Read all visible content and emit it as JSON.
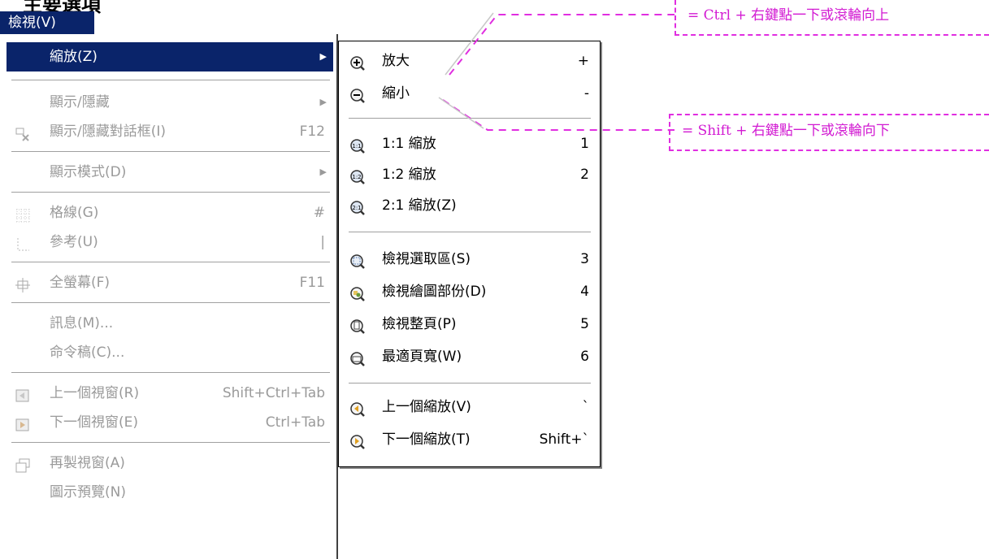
{
  "page": {
    "heading": "主要選項"
  },
  "menubar": {
    "view_label": "檢視(V)"
  },
  "main_menu": {
    "items": [
      {
        "label": "縮放(Z)",
        "shortcut": "",
        "has_submenu": true,
        "enabled": true,
        "highlighted": true,
        "icon": ""
      },
      {
        "label": "顯示/隱藏",
        "shortcut": "",
        "has_submenu": true,
        "enabled": false,
        "icon": ""
      },
      {
        "label": "顯示/隱藏對話框(I)",
        "shortcut": "F12",
        "has_submenu": false,
        "enabled": false,
        "icon": "toggle-dialogs-icon"
      },
      {
        "label": "顯示模式(D)",
        "shortcut": "",
        "has_submenu": true,
        "enabled": false,
        "icon": ""
      },
      {
        "label": "格線(G)",
        "shortcut": "#",
        "has_submenu": false,
        "enabled": false,
        "icon": "grid-icon"
      },
      {
        "label": "參考(U)",
        "shortcut": "|",
        "has_submenu": false,
        "enabled": false,
        "icon": "guides-icon"
      },
      {
        "label": "全螢幕(F)",
        "shortcut": "F11",
        "has_submenu": false,
        "enabled": false,
        "icon": "fullscreen-icon"
      },
      {
        "label": "訊息(M)...",
        "shortcut": "",
        "has_submenu": false,
        "enabled": false,
        "icon": ""
      },
      {
        "label": "命令稿(C)...",
        "shortcut": "",
        "has_submenu": false,
        "enabled": false,
        "icon": ""
      },
      {
        "label": "上一個視窗(R)",
        "shortcut": "Shift+Ctrl+Tab",
        "has_submenu": false,
        "enabled": false,
        "icon": "prev-window-icon"
      },
      {
        "label": "下一個視窗(E)",
        "shortcut": "Ctrl+Tab",
        "has_submenu": false,
        "enabled": false,
        "icon": "next-window-icon"
      },
      {
        "label": "再製視窗(A)",
        "shortcut": "",
        "has_submenu": false,
        "enabled": false,
        "icon": "duplicate-window-icon"
      },
      {
        "label": "圖示預覽(N)",
        "shortcut": "",
        "has_submenu": false,
        "enabled": false,
        "icon": ""
      }
    ]
  },
  "zoom_submenu": {
    "items": [
      {
        "label": "放大",
        "shortcut": "+",
        "icon": "zoom-in-icon"
      },
      {
        "label": "縮小",
        "shortcut": "-",
        "icon": "zoom-out-icon"
      },
      {
        "label": "1:1 縮放",
        "shortcut": "1",
        "icon": "zoom-1-1-icon"
      },
      {
        "label": "1:2 縮放",
        "shortcut": "2",
        "icon": "zoom-1-2-icon"
      },
      {
        "label": "2:1 縮放(Z)",
        "shortcut": "",
        "icon": "zoom-2-1-icon"
      },
      {
        "label": "檢視選取區(S)",
        "shortcut": "3",
        "icon": "zoom-selection-icon"
      },
      {
        "label": "檢視繪圖部份(D)",
        "shortcut": "4",
        "icon": "zoom-drawing-icon"
      },
      {
        "label": "檢視整頁(P)",
        "shortcut": "5",
        "icon": "zoom-page-icon"
      },
      {
        "label": "最適頁寬(W)",
        "shortcut": "6",
        "icon": "zoom-width-icon"
      },
      {
        "label": "上一個縮放(V)",
        "shortcut": "`",
        "icon": "zoom-prev-icon"
      },
      {
        "label": "下一個縮放(T)",
        "shortcut": "Shift+`",
        "icon": "zoom-next-icon"
      }
    ]
  },
  "annotations": {
    "zoom_in_note": "= Ctrl +  右鍵點一下或滾輪向上",
    "zoom_out_note": "= Shift +  右鍵點一下或滾輪向下"
  },
  "colors": {
    "highlight": "#0a246a",
    "disabled_text": "#9a9a9a",
    "annotation": "#e02ee0"
  }
}
